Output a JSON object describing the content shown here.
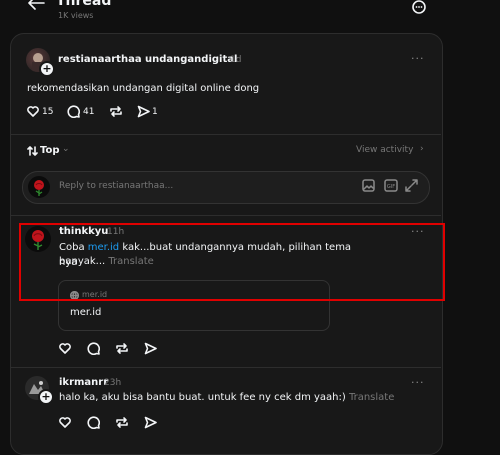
{
  "header": {
    "title": "Thread",
    "views": "1K views"
  },
  "post": {
    "author": "restianaarthaa",
    "reply_to": "undangandigital",
    "time": "1d",
    "text": "rekomendasikan undangan digital online dong",
    "likes": "15",
    "comments": "41",
    "shares": "1"
  },
  "sort": {
    "label": "Top",
    "view_activity": "View activity"
  },
  "reply_box": {
    "placeholder": "Reply to restianaarthaa..."
  },
  "replies": [
    {
      "author": "thinkkyu",
      "time": "11h",
      "text_before": "Coba ",
      "link": "mer.id",
      "text_after": " kak...buat undangannya mudah, pilihan tema nya",
      "text_line2": "banyak...",
      "translate": "Translate",
      "card_domain": "mer.id",
      "card_title": "mer.id"
    },
    {
      "author": "ikrmanrr",
      "time": "23h",
      "text": "halo ka, aku bisa bantu buat. untuk fee ny cek dm yaah:)",
      "translate": "Translate"
    }
  ],
  "colors": {
    "background": "#101010",
    "panel": "#181818",
    "link": "#1d9bf0",
    "highlight": "#e00000"
  }
}
